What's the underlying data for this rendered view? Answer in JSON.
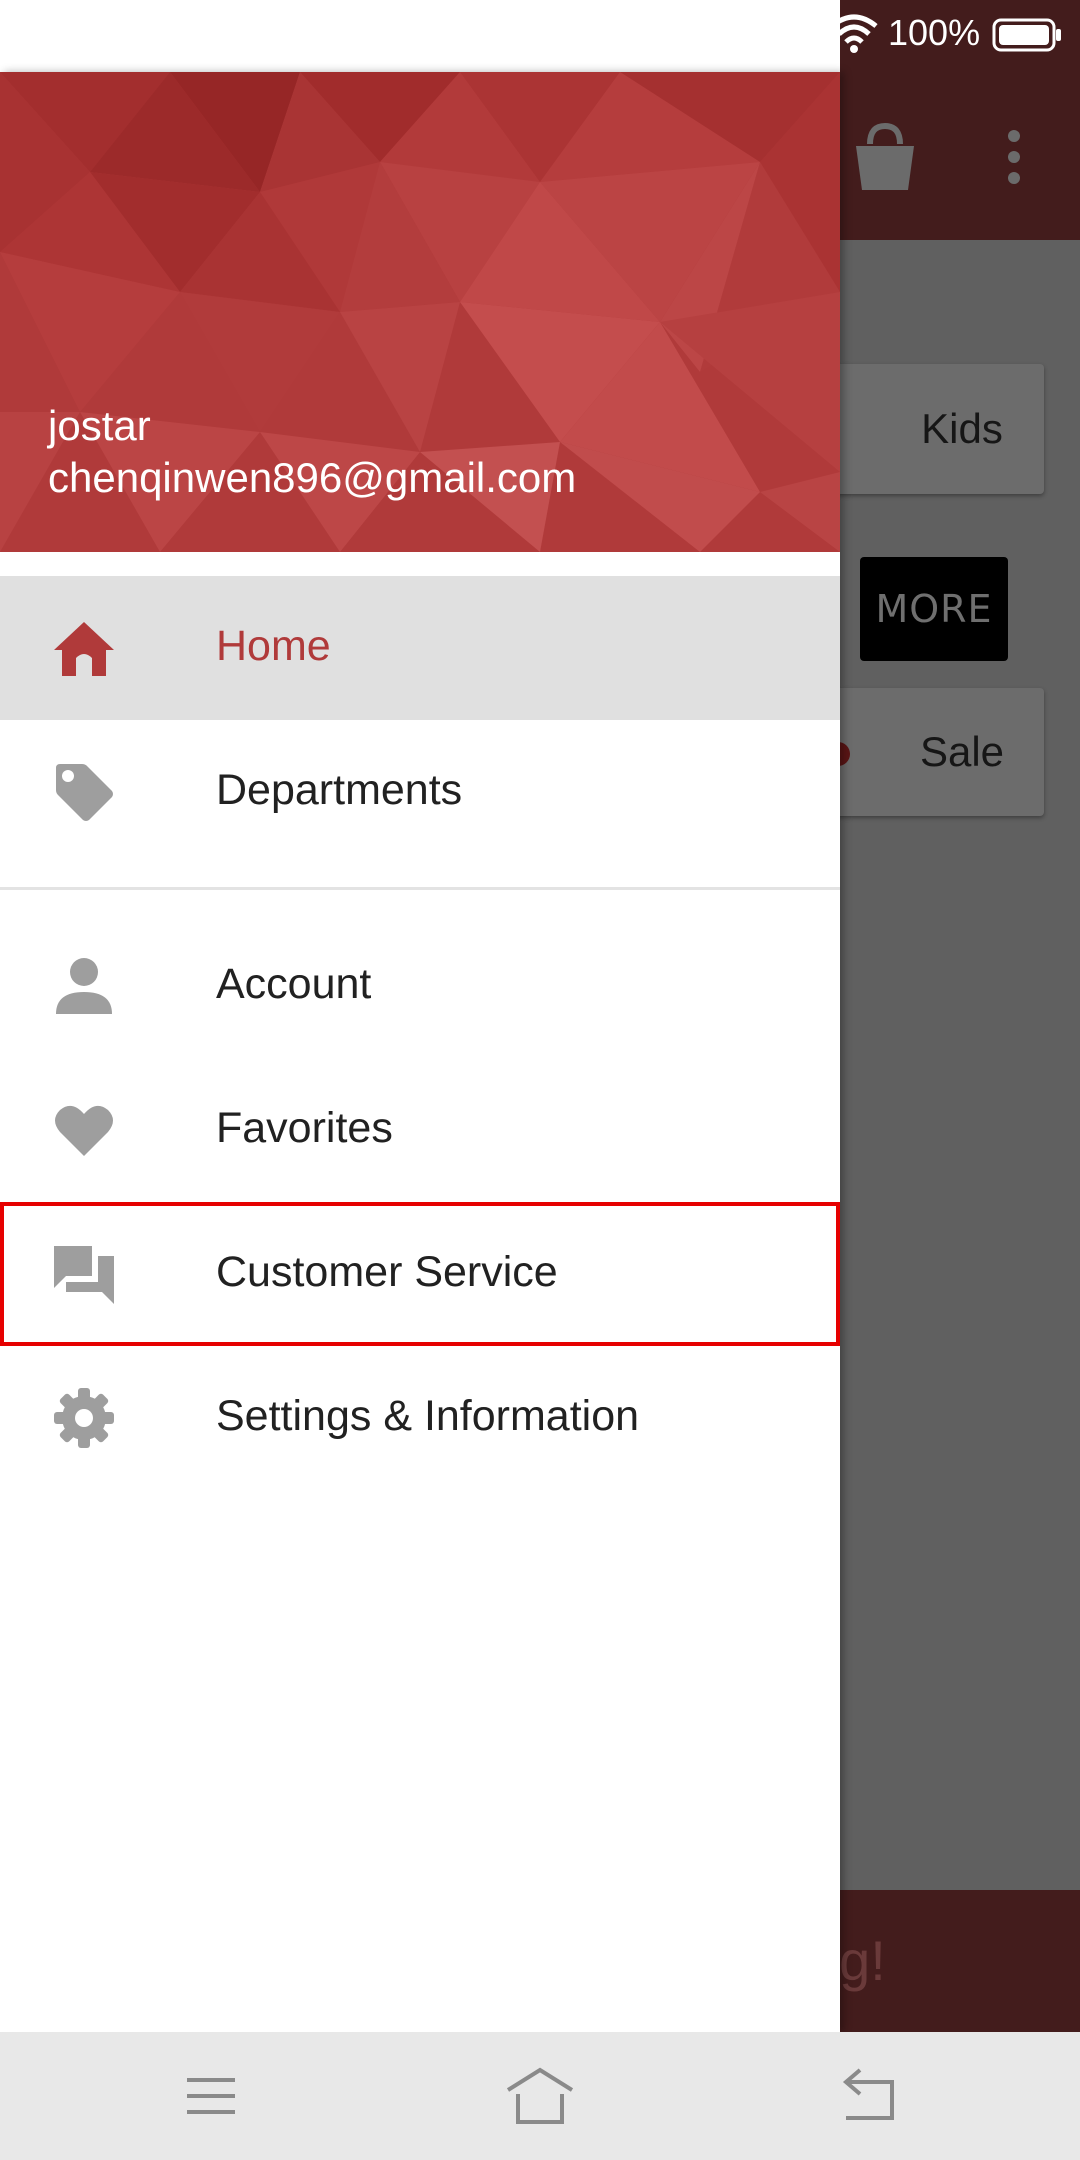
{
  "status_bar": {
    "battery": "100%"
  },
  "app_background": {
    "chips": [
      "Kids",
      "Sale"
    ],
    "more_button": "MORE",
    "banner_text": "ng!"
  },
  "drawer": {
    "user": {
      "name": "jostar",
      "email": "chenqinwen896@gmail.com"
    },
    "menu": [
      {
        "label": "Home",
        "icon": "home-icon",
        "selected": true
      },
      {
        "label": "Departments",
        "icon": "tag-icon"
      },
      {
        "label": "Account",
        "icon": "person-icon"
      },
      {
        "label": "Favorites",
        "icon": "heart-icon"
      },
      {
        "label": "Customer Service",
        "icon": "chat-icon",
        "highlighted": true
      },
      {
        "label": "Settings & Information",
        "icon": "gear-icon"
      }
    ]
  },
  "nav_bar": {
    "buttons": [
      "menu-icon",
      "home-icon",
      "back-icon"
    ]
  },
  "colors": {
    "accent": "#b03a3a",
    "toolbar": "#431c1c",
    "highlight_outline": "#e60000",
    "icon_gray": "#9e9e9e"
  }
}
